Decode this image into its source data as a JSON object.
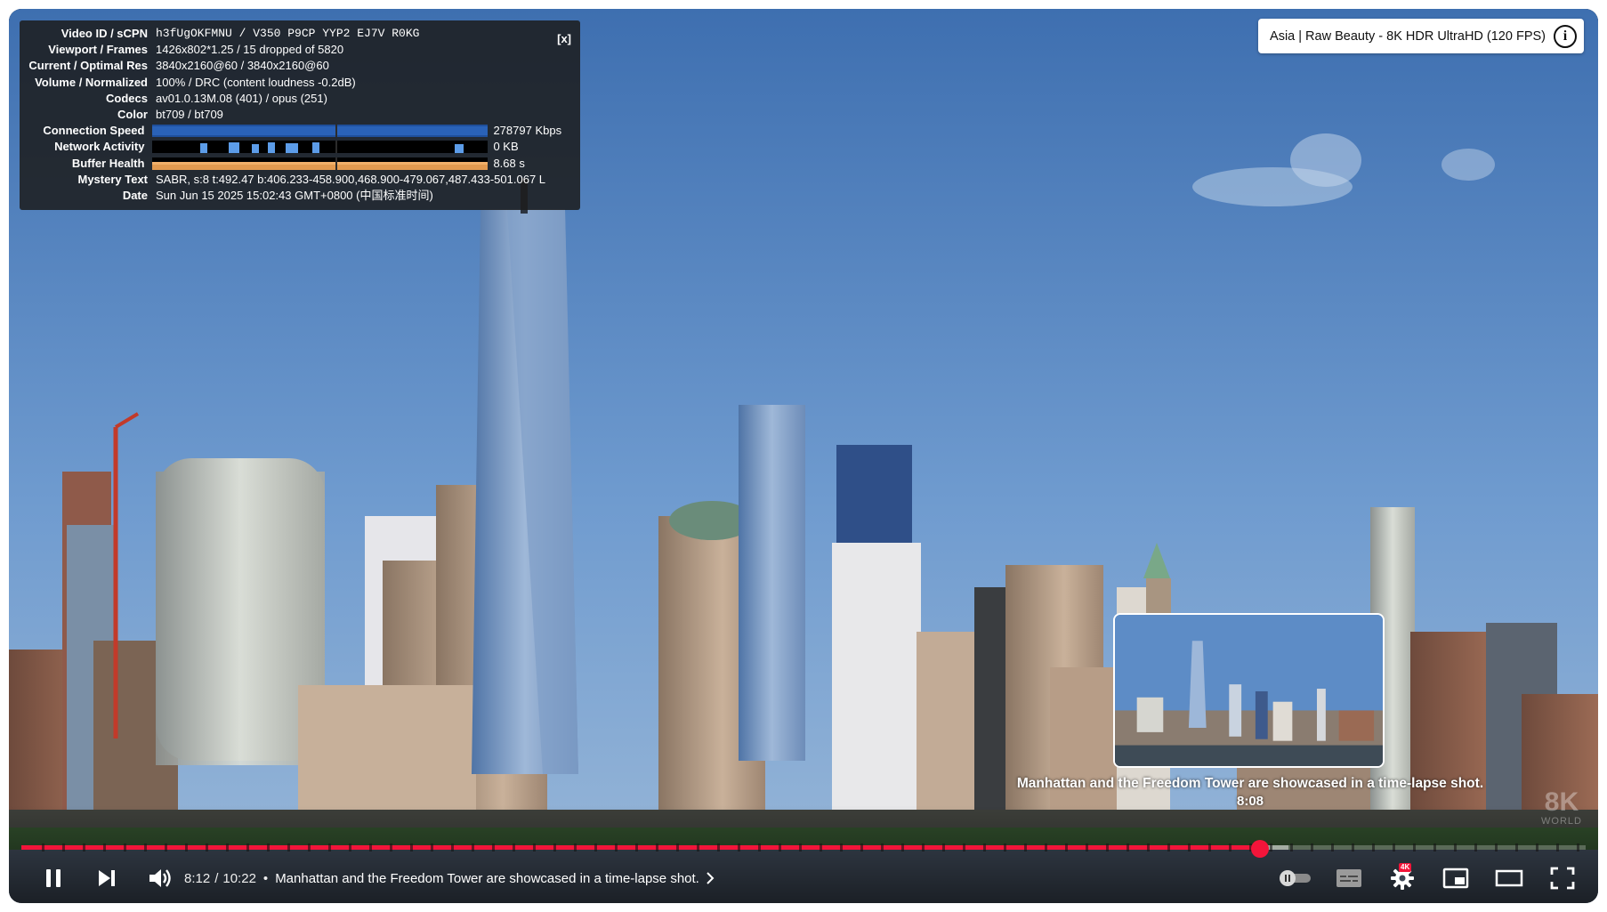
{
  "stats": {
    "close_label": "[x]",
    "rows": [
      {
        "label": "Video ID / sCPN",
        "value": "h3fUgOKFMNU / V350 P9CP YYP2 EJ7V R0KG"
      },
      {
        "label": "Viewport / Frames",
        "value": "1426x802*1.25 / 15 dropped of 5820"
      },
      {
        "label": "Current / Optimal Res",
        "value": "3840x2160@60 / 3840x2160@60"
      },
      {
        "label": "Volume / Normalized",
        "value": "100% / DRC (content loudness -0.2dB)"
      },
      {
        "label": "Codecs",
        "value": "av01.0.13M.08 (401) / opus (251)"
      },
      {
        "label": "Color",
        "value": "bt709 / bt709"
      },
      {
        "label": "Connection Speed",
        "value": "278797 Kbps"
      },
      {
        "label": "Network Activity",
        "value": "0 KB"
      },
      {
        "label": "Buffer Health",
        "value": "8.68 s"
      },
      {
        "label": "Mystery Text",
        "value": "SABR, s:8 t:492.47 b:406.233-458.900,468.900-479.067,487.433-501.067 L"
      },
      {
        "label": "Date",
        "value": "Sun Jun 15 2025 15:02:43 GMT+0800 (中国标准时间)"
      }
    ]
  },
  "video_title": "Asia | Raw Beauty - 8K HDR UltraHD (120 FPS)",
  "info_icon": "info-icon",
  "preview": {
    "chapter": "Manhattan and the Freedom Tower are showcased in a time-lapse shot.",
    "time": "8:08"
  },
  "watermark": {
    "big": "8K",
    "small": "WORLD"
  },
  "progress": {
    "played_fraction": 0.792,
    "loaded_fraction": 0.81,
    "hover_fraction": 0.778
  },
  "controls": {
    "current_time": "8:12",
    "separator": "/",
    "duration": "10:22",
    "dot": "•",
    "chapter": "Manhattan and the Freedom Tower are showcased in a time-lapse shot.",
    "quality_badge": "4K"
  },
  "colors": {
    "accent": "#f3153a",
    "sky": "#5c89c4"
  }
}
